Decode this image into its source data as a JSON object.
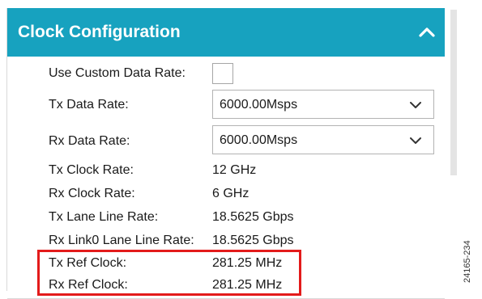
{
  "panel": {
    "title": "Clock Configuration",
    "collapse_icon": "chevron-up-icon",
    "header_color": "#17a2bf"
  },
  "fields": {
    "custom_data_rate_label": "Use Custom Data Rate:",
    "custom_data_rate_checked": false,
    "tx_data_rate_label": "Tx Data Rate:",
    "tx_data_rate_value": "6000.00Msps",
    "rx_data_rate_label": "Rx Data Rate:",
    "rx_data_rate_value": "6000.00Msps",
    "dropdown_icon": "chevron-down-icon"
  },
  "readouts": {
    "tx_clock_rate_label": "Tx Clock Rate:",
    "tx_clock_rate_value": "12 GHz",
    "rx_clock_rate_label": "Rx Clock Rate:",
    "rx_clock_rate_value": "6 GHz",
    "tx_lane_line_rate_label": "Tx Lane Line Rate:",
    "tx_lane_line_rate_value": "18.5625 Gbps",
    "rx_link0_lane_line_rate_label": "Rx Link0 Lane Line Rate:",
    "rx_link0_lane_line_rate_value": "18.5625 Gbps",
    "tx_ref_clock_label": "Tx Ref Clock:",
    "tx_ref_clock_value": "281.25 MHz",
    "rx_ref_clock_label": "Rx Ref Clock:",
    "rx_ref_clock_value": "281.25 MHz"
  },
  "highlight_color": "#e31b1b",
  "figure_id": "24165-234"
}
